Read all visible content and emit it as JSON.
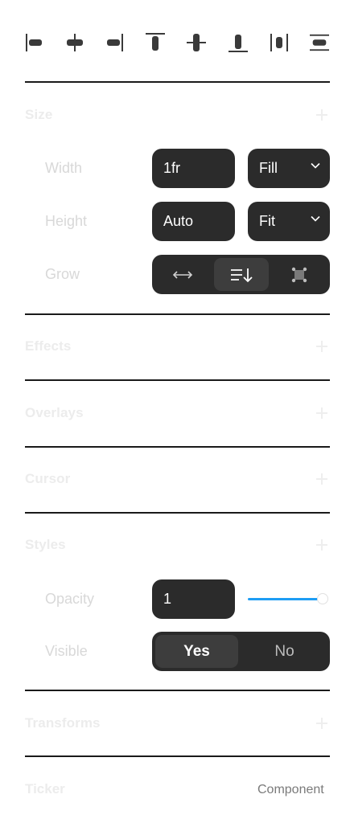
{
  "alignment_toolbar": {
    "buttons": [
      "align-left",
      "align-center-horizontal",
      "align-right",
      "align-top",
      "align-center-vertical",
      "align-bottom",
      "distribute-horizontal",
      "distribute-vertical"
    ]
  },
  "sections": {
    "size": {
      "title": "Size",
      "width": {
        "label": "Width",
        "value": "1fr",
        "mode": "Fill"
      },
      "height": {
        "label": "Height",
        "value": "Auto",
        "mode": "Fit"
      },
      "grow": {
        "label": "Grow",
        "options": [
          "horizontal-arrows-icon",
          "wrap-down-icon",
          "free-transform-icon"
        ],
        "selected_index": 1
      }
    },
    "effects": {
      "title": "Effects"
    },
    "overlays": {
      "title": "Overlays"
    },
    "cursor": {
      "title": "Cursor"
    },
    "styles": {
      "title": "Styles",
      "opacity": {
        "label": "Opacity",
        "value": "1",
        "slider_level": 1.0
      },
      "visible": {
        "label": "Visible",
        "options": [
          "Yes",
          "No"
        ],
        "selected": "Yes"
      }
    },
    "transforms": {
      "title": "Transforms"
    },
    "ticker": {
      "title": "Ticker",
      "tag": "Component"
    }
  },
  "colors": {
    "field_bg": "#2b2b2b",
    "accent": "#1e9df4",
    "divider": "#1a1a1a"
  }
}
